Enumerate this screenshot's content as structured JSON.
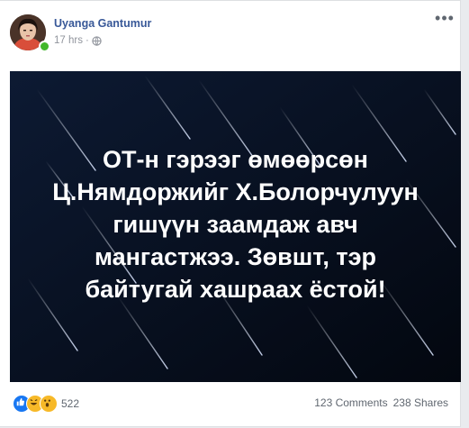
{
  "post": {
    "author_name": "Uyanga Gantumur",
    "timestamp": "17 hrs",
    "separator": "·",
    "privacy_icon": "globe-icon",
    "more_icon": "more-options-icon",
    "image_text": "ОТ-н гэрээг өмөөрсөн\nЦ.Нямдоржийг Х.Болорчулуун\nгишүүн заамдаж авч\nмангастжээ. Зөвшт, тэр\nбайтугай хашраах ёстой!"
  },
  "footer": {
    "reaction_icons": [
      "like-icon",
      "haha-icon",
      "wow-icon"
    ],
    "reaction_count": "522",
    "comments": "123 Comments",
    "shares": "238 Shares"
  },
  "colors": {
    "link_blue": "#385898",
    "meta_gray": "#90949c",
    "image_bg": "#050b1c",
    "online_green": "#42b72a"
  }
}
